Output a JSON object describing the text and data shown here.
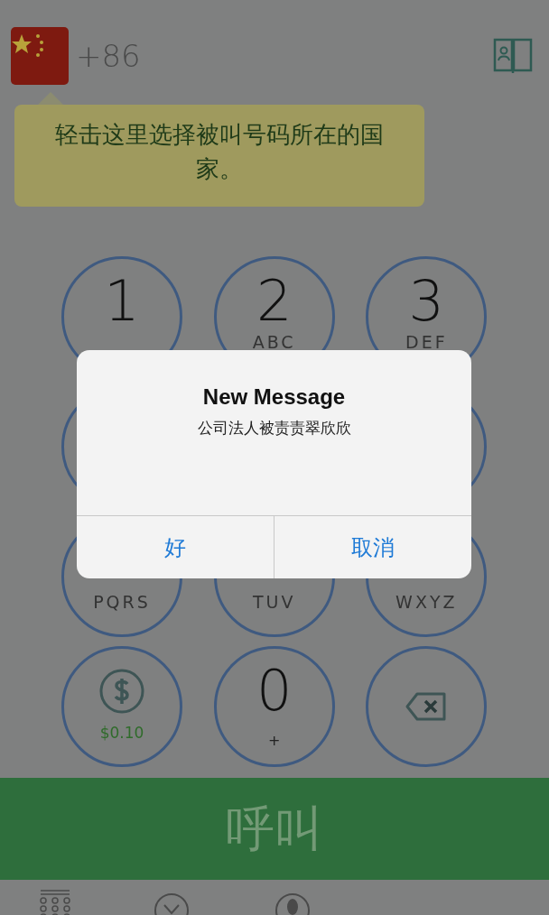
{
  "header": {
    "country_code": "+86"
  },
  "tooltip": {
    "text": "轻击这里选择被叫号码所在的国家。"
  },
  "keys": [
    {
      "kind": "digit",
      "digit": "1"
    },
    {
      "kind": "digit",
      "digit": "2",
      "letters": "ABC"
    },
    {
      "kind": "digit",
      "digit": "3",
      "letters": "DEF"
    },
    {
      "kind": "blank"
    },
    {
      "kind": "hidden"
    },
    {
      "kind": "blank"
    },
    {
      "kind": "digit",
      "letters": "PQRS"
    },
    {
      "kind": "digit",
      "letters": "TUV"
    },
    {
      "kind": "digit",
      "letters": "WXYZ"
    },
    {
      "kind": "rate",
      "letters": "$0.10"
    },
    {
      "kind": "digit",
      "digit": "0",
      "letters": "+"
    },
    {
      "kind": "delete"
    }
  ],
  "call_button": {
    "label": "呼叫"
  },
  "dialog": {
    "title": "New Message",
    "message": "公司法人被责责翠欣欣",
    "buttons": [
      "好",
      "取消"
    ]
  }
}
